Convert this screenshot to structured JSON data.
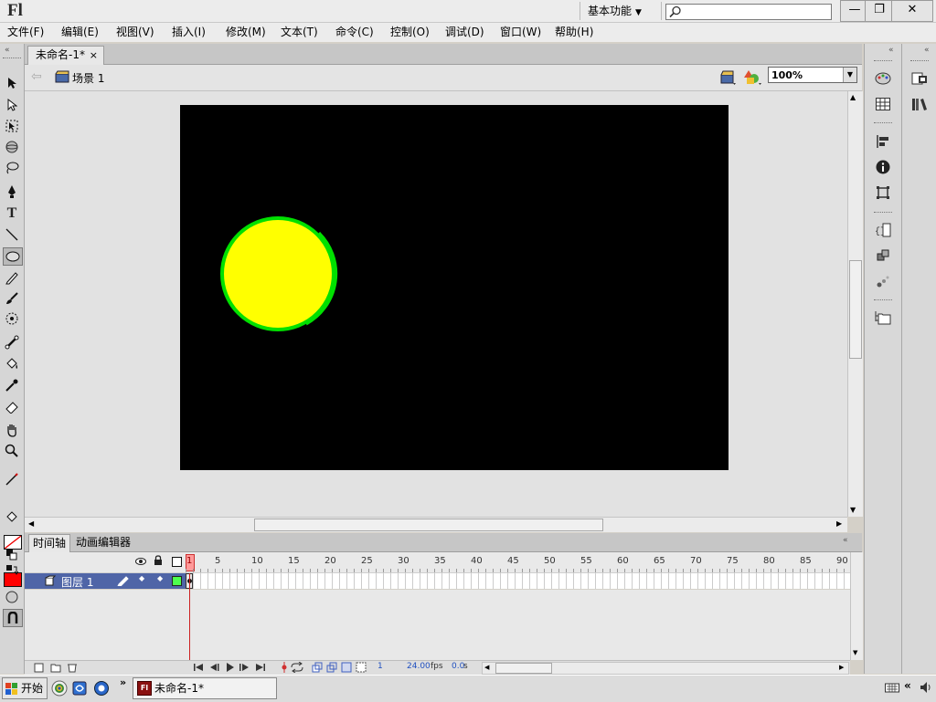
{
  "app": {
    "logo": "Fl",
    "workspace": "基本功能",
    "window_controls": [
      "minimize-icon",
      "restore-icon",
      "close-icon"
    ]
  },
  "menu": {
    "items": [
      "文件(F)",
      "编辑(E)",
      "视图(V)",
      "插入(I)",
      "修改(M)",
      "文本(T)",
      "命令(C)",
      "控制(O)",
      "调试(D)",
      "窗口(W)",
      "帮助(H)"
    ]
  },
  "document": {
    "tab_title": "未命名-1*",
    "scene": "场景 1",
    "zoom": "100%"
  },
  "stage": {
    "background": "#000000",
    "circle_fill": "#ffff00",
    "circle_stroke": "#00e000"
  },
  "timeline": {
    "tabs": [
      "时间轴",
      "动画编辑器"
    ],
    "frame_numbers": [
      "1",
      "5",
      "10",
      "15",
      "20",
      "25",
      "30",
      "35",
      "40",
      "45",
      "50",
      "55",
      "60",
      "65",
      "70",
      "75",
      "80",
      "85",
      "90"
    ],
    "layer_name": "图层 1",
    "status": {
      "current_frame": "1",
      "fps": "24.00",
      "fps_unit": "fps",
      "time": "0.0",
      "time_unit": "s"
    }
  },
  "tools": {
    "stroke_color": "#000000",
    "fill_color": "#ff0000"
  },
  "taskbar": {
    "start_label": "开始",
    "task_label": "未命名-1*"
  }
}
